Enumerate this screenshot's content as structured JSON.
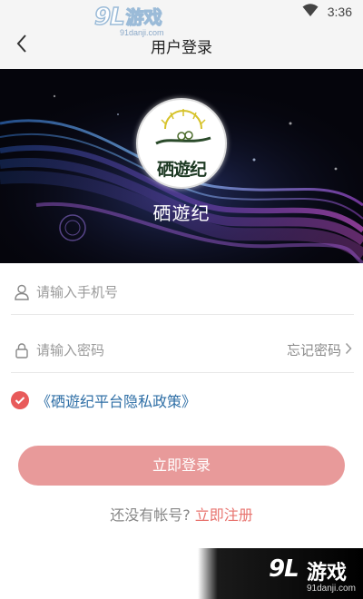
{
  "status_bar": {
    "time": "3:36",
    "wifi_icon": "wifi-icon"
  },
  "watermark": {
    "brand_num": "9L",
    "brand_cn": "游戏",
    "url": "91danji.com"
  },
  "nav": {
    "title": "用户登录",
    "back_icon": "chevron-left-icon"
  },
  "banner": {
    "logo_text": "硒遊纪",
    "app_name": "硒遊纪"
  },
  "form": {
    "phone": {
      "placeholder": "请输入手机号",
      "value": "",
      "icon": "user-icon"
    },
    "password": {
      "placeholder": "请输入密码",
      "value": "",
      "icon": "lock-icon"
    },
    "forgot_label": "忘记密码"
  },
  "policy": {
    "checked": true,
    "label": "《硒遊纪平台隐私政策》"
  },
  "login_button": "立即登录",
  "register": {
    "question": "还没有帐号?",
    "link": "立即注册"
  },
  "colors": {
    "accent": "#e85a5a",
    "button": "#e89a9a",
    "link": "#2f6fa6",
    "register_link": "#e8736e"
  }
}
